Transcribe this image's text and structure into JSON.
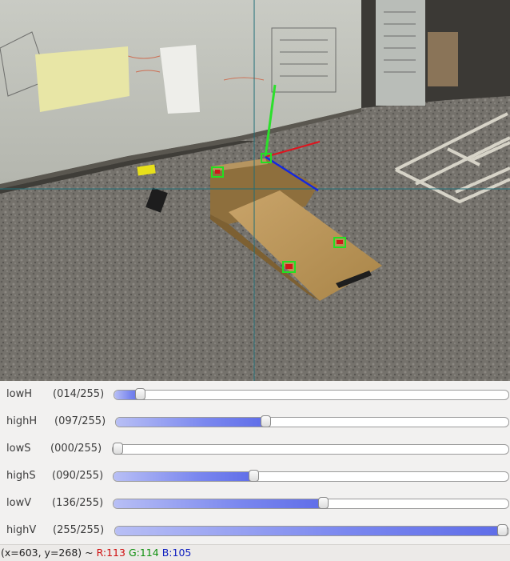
{
  "view": {
    "name": "camera-feed"
  },
  "trackbars": [
    {
      "id": "lowH",
      "label": "lowH",
      "value_text": "(014/255)",
      "value": 14,
      "max": 255
    },
    {
      "id": "highH",
      "label": "highH",
      "value_text": "(097/255)",
      "value": 97,
      "max": 255
    },
    {
      "id": "lowS",
      "label": "lowS",
      "value_text": "(000/255)",
      "value": 0,
      "max": 255
    },
    {
      "id": "highS",
      "label": "highS",
      "value_text": "(090/255)",
      "value": 90,
      "max": 255
    },
    {
      "id": "lowV",
      "label": "lowV",
      "value_text": "(136/255)",
      "value": 136,
      "max": 255
    },
    {
      "id": "highV",
      "label": "highV",
      "value_text": "(255/255)",
      "value": 255,
      "max": 255
    }
  ],
  "status": {
    "coords": "(x=603, y=268) ~",
    "r": "R:113",
    "g": "G:114",
    "b": "B:105"
  },
  "colors": {
    "slider_fill": "#6f7cec",
    "axis_x": "#e0141e",
    "axis_y": "#2ce02c",
    "axis_z": "#1428e0",
    "marker": "#22e022",
    "crosshair": "#1f6e78"
  }
}
